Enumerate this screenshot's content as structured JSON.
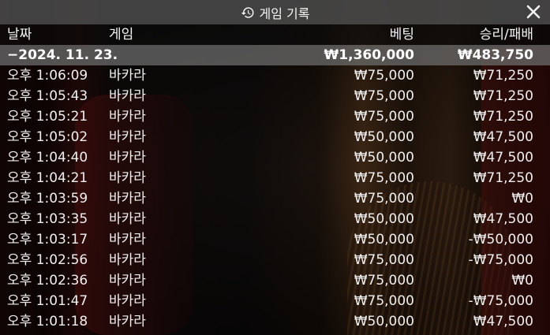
{
  "window": {
    "title": "게임 기록",
    "close_icon": "close-icon",
    "history_icon": "history-icon"
  },
  "columns": {
    "date": "날짜",
    "game": "게임",
    "bet": "베팅",
    "win": "승리/패배"
  },
  "summary": {
    "date": "−2024. 11. 23.",
    "bet": "₩1,360,000",
    "win": "₩483,750"
  },
  "rows": [
    {
      "time": "오후 1:06:09",
      "game": "바카라",
      "bet": "₩75,000",
      "win": "₩71,250"
    },
    {
      "time": "오후 1:05:43",
      "game": "바카라",
      "bet": "₩75,000",
      "win": "₩71,250"
    },
    {
      "time": "오후 1:05:21",
      "game": "바카라",
      "bet": "₩75,000",
      "win": "₩71,250"
    },
    {
      "time": "오후 1:05:02",
      "game": "바카라",
      "bet": "₩50,000",
      "win": "₩47,500"
    },
    {
      "time": "오후 1:04:40",
      "game": "바카라",
      "bet": "₩50,000",
      "win": "₩47,500"
    },
    {
      "time": "오후 1:04:21",
      "game": "바카라",
      "bet": "₩75,000",
      "win": "₩71,250"
    },
    {
      "time": "오후 1:03:59",
      "game": "바카라",
      "bet": "₩75,000",
      "win": "₩0"
    },
    {
      "time": "오후 1:03:35",
      "game": "바카라",
      "bet": "₩50,000",
      "win": "₩47,500"
    },
    {
      "time": "오후 1:03:17",
      "game": "바카라",
      "bet": "₩50,000",
      "win": "-₩50,000"
    },
    {
      "time": "오후 1:02:56",
      "game": "바카라",
      "bet": "₩75,000",
      "win": "-₩75,000"
    },
    {
      "time": "오후 1:02:36",
      "game": "바카라",
      "bet": "₩75,000",
      "win": "₩0"
    },
    {
      "time": "오후 1:01:47",
      "game": "바카라",
      "bet": "₩75,000",
      "win": "-₩75,000"
    },
    {
      "time": "오후 1:01:18",
      "game": "바카라",
      "bet": "₩50,000",
      "win": "₩47,500"
    }
  ]
}
